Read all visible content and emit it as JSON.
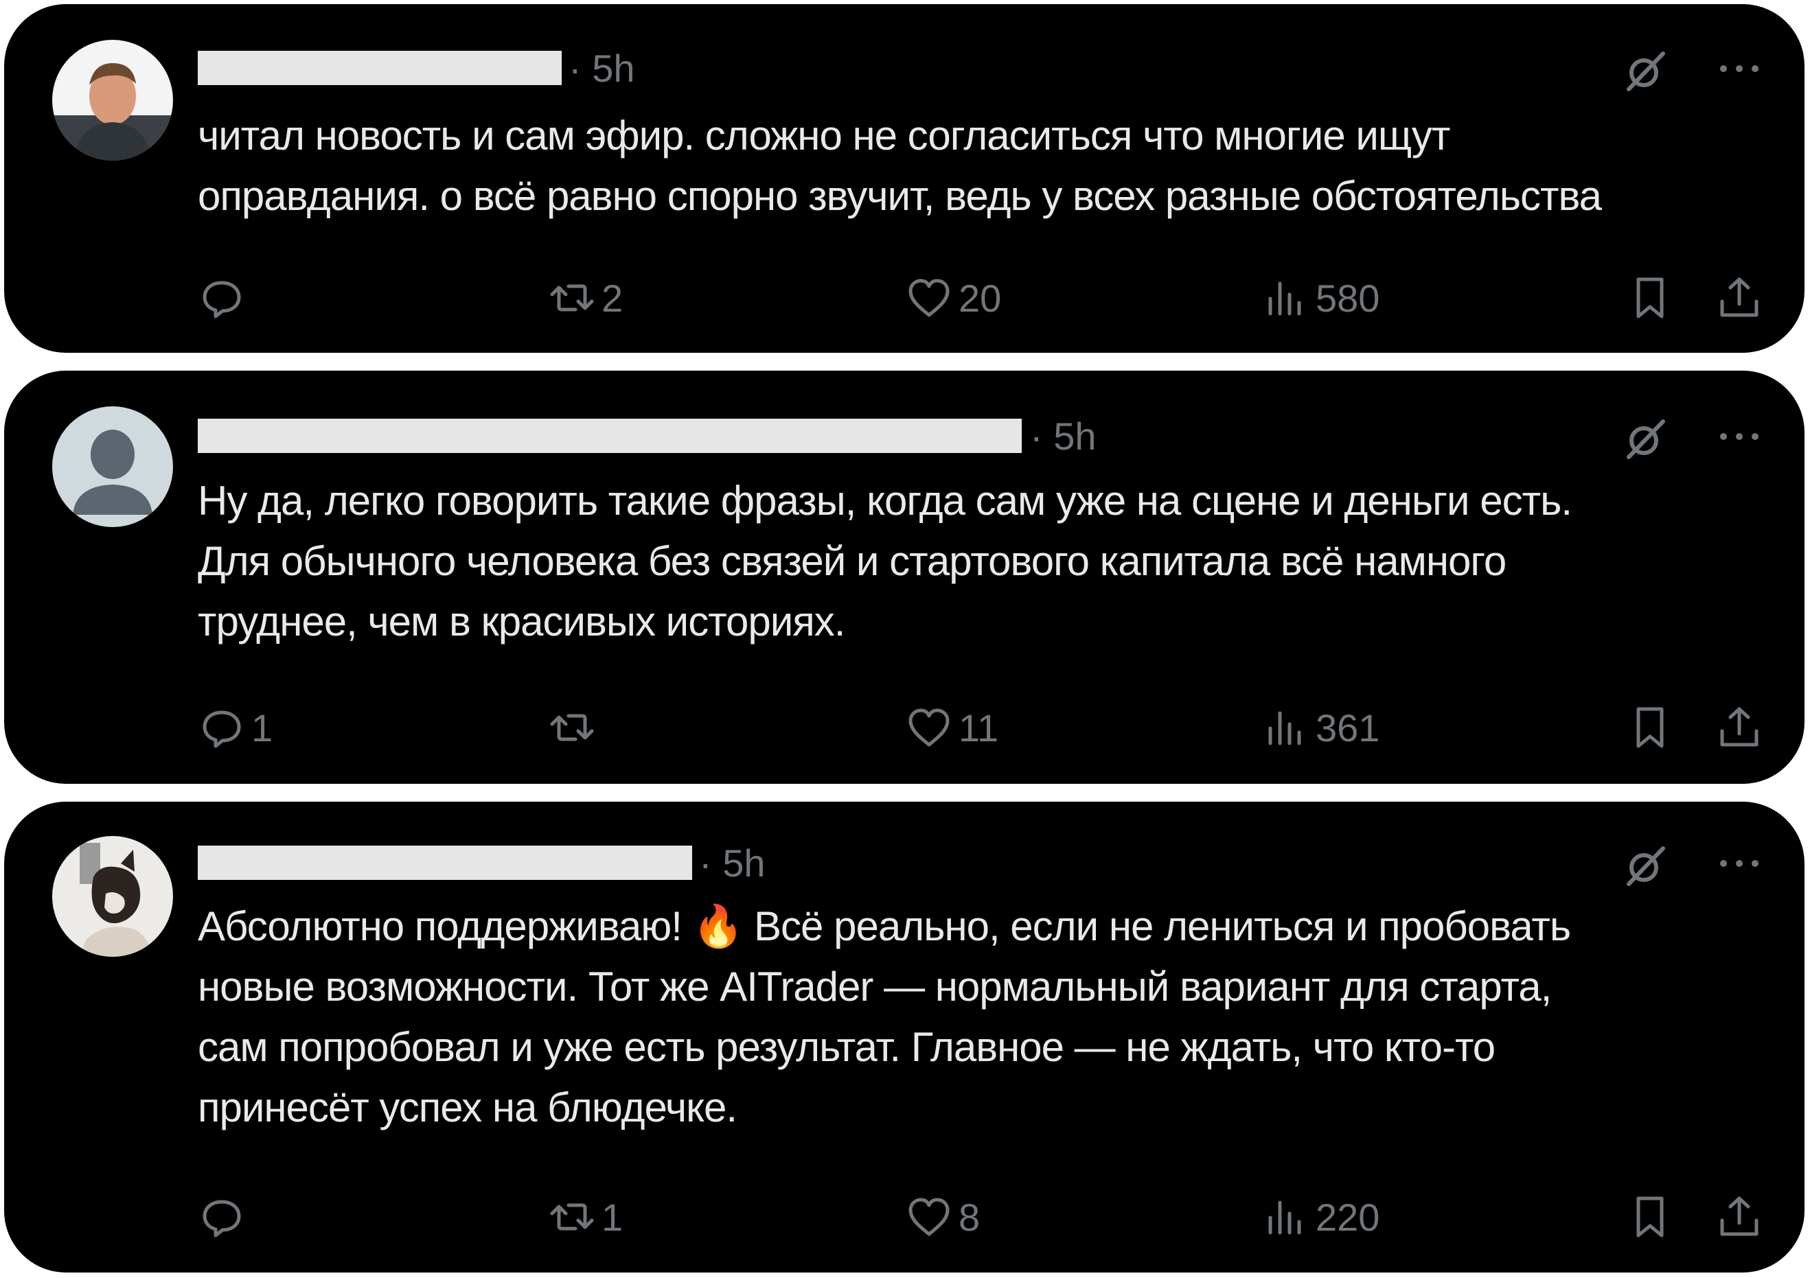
{
  "posts": [
    {
      "timestamp": "· 5h",
      "text": "читал новость и сам эфир. сложно не согласиться что многие ищут\nоправдания. о всё равно спорно звучит, ведь у всех разные обстоятельства",
      "avatar_icon": "user-photo-avatar",
      "replies": "",
      "reposts": "2",
      "likes": "20",
      "views": "580"
    },
    {
      "timestamp": "· 5h",
      "text": "Ну да, легко говорить такие фразы, когда сам уже на сцене и деньги есть.\nДля обычного человека без связей и стартового капитала всё намного\nтруднее, чем в красивых историях.",
      "avatar_icon": "default-profile-avatar",
      "replies": "1",
      "reposts": "",
      "likes": "11",
      "views": "361"
    },
    {
      "timestamp": "· 5h",
      "text": "Абсолютно поддерживаю! 🔥 Всё реально, если не лениться и пробовать\nновые возможности. Тот же AITrader — нормальный вариант для старта,\nсам попробовал и уже есть результат. Главное — не ждать, что кто-то\nпринесёт успех на блюдечке.",
      "avatar_icon": "dog-photo-avatar",
      "replies": "",
      "reposts": "1",
      "likes": "8",
      "views": "220"
    }
  ],
  "colors": {
    "background": "#000000",
    "text": "#e7e9ea",
    "muted": "#71767b",
    "redaction": "#e6e6e6"
  }
}
